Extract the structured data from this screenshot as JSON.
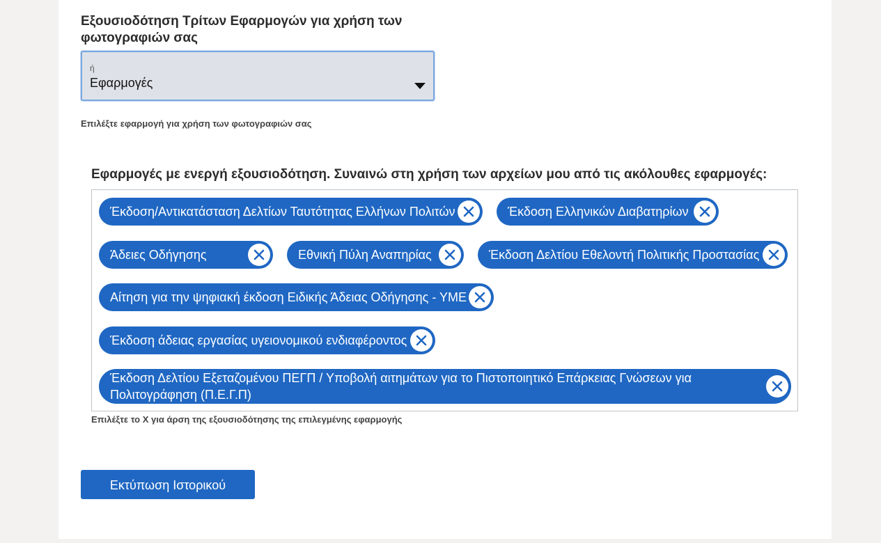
{
  "authorization": {
    "title": "Εξουσιοδότηση Τρίτων Εφαρμογών για χρήση των φωτογραφιών σας",
    "select": {
      "small_label": "ή",
      "value": "Εφαρμογές"
    },
    "hint": "Επιλέξτε εφαρμογή για χρήση των φωτογραφιών σας"
  },
  "active": {
    "title": "Εφαρμογές με ενεργή εξουσιοδότηση. Συναινώ στη χρήση των αρχείων μου από τις ακόλουθες εφαρμογές:",
    "chips": [
      {
        "label": "Έκδοση/Αντικατάσταση Δελτίων Ταυτότητας Ελλήνων Πολιτών"
      },
      {
        "label": "Έκδοση Ελληνικών Διαβατηρίων"
      },
      {
        "label": "Άδειες Οδήγησης"
      },
      {
        "label": "Εθνική Πύλη Αναπηρίας"
      },
      {
        "label": "Έκδοση Δελτίου Εθελοντή Πολιτικής Προστασίας"
      },
      {
        "label": "Αίτηση για την ψηφιακή έκδοση Ειδικής Άδειας Οδήγησης - ΥΜΕ"
      },
      {
        "label": "Έκδοση άδειας εργασίας υγειονομικού ενδιαφέροντος"
      },
      {
        "label": "Έκδοση Δελτίου Εξεταζομένου ΠΕΓΠ / Υποβολή αιτημάτων για το Πιστοποιητικό Επάρκειας Γνώσεων για Πολιτογράφηση (Π.Ε.Γ.Π)"
      }
    ],
    "hint_prefix": "Επιλέξτε το",
    "hint_x": "Χ",
    "hint_suffix": "για άρση της εξουσιοδότησης της επιλεγμένης εφαρμογής"
  },
  "print_button": "Εκτύπωση Ιστορικού",
  "colors": {
    "accent": "#1f67c3",
    "select_bg": "#dee2e8",
    "page_bg": "#f3f2f1"
  }
}
